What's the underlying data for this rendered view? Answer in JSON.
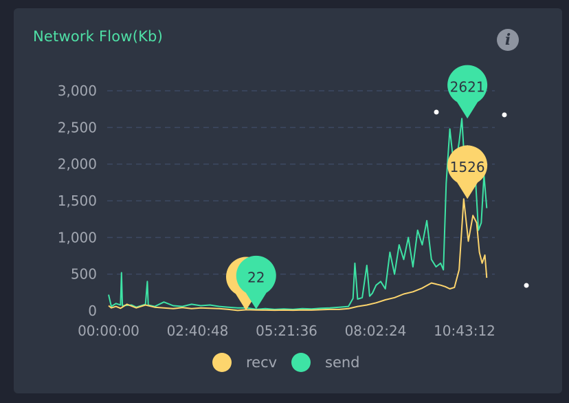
{
  "header": {
    "title": "Network Flow(Kb)",
    "info_icon": "info-icon",
    "info_glyph": "i"
  },
  "chart_data": {
    "type": "line",
    "title": "Network Flow(Kb)",
    "xlabel": "",
    "ylabel": "",
    "ylim": [
      0,
      3000
    ],
    "yticks": [
      0,
      500,
      1000,
      1500,
      2000,
      2500,
      3000
    ],
    "ytick_labels": [
      "0",
      "500",
      "1,000",
      "1,500",
      "2,000",
      "2,500",
      "3,000"
    ],
    "xtick_labels": [
      "00:00:00",
      "02:40:48",
      "05:21:36",
      "08:02:24",
      "10:43:12"
    ],
    "xtick_seconds": [
      0,
      9648,
      19296,
      28944,
      38592
    ],
    "grid": "horizontal dashed",
    "legend_position": "bottom",
    "series": [
      {
        "name": "recv",
        "color": "#fdd56d",
        "x": [
          0,
          300,
          800,
          1300,
          2000,
          3000,
          4000,
          5000,
          6000,
          7000,
          8000,
          9000,
          10000,
          11000,
          12000,
          13000,
          14000,
          15000,
          16000,
          17000,
          18000,
          19000,
          20000,
          21000,
          22000,
          23000,
          24000,
          25000,
          26000,
          27000,
          28000,
          29000,
          30000,
          31000,
          32000,
          33000,
          34000,
          35000,
          36000,
          36500,
          37000,
          37500,
          38000,
          38500,
          39000,
          39500,
          39900,
          40200,
          40500,
          40800,
          41000
        ],
        "y": [
          70,
          40,
          60,
          35,
          90,
          40,
          80,
          50,
          40,
          30,
          45,
          30,
          40,
          35,
          30,
          20,
          6,
          15,
          12,
          10,
          8,
          10,
          8,
          12,
          10,
          15,
          20,
          20,
          30,
          60,
          80,
          110,
          150,
          180,
          230,
          260,
          310,
          380,
          350,
          330,
          300,
          320,
          560,
          1526,
          950,
          1300,
          1200,
          800,
          650,
          760,
          450
        ],
        "markers": [
          {
            "x": 14900,
            "y": 6,
            "label": "6"
          },
          {
            "x": 38900,
            "y": 1526,
            "label": "1526"
          }
        ]
      },
      {
        "name": "send",
        "color": "#3ee3a5",
        "x": [
          0,
          300,
          800,
          1300,
          1400,
          1500,
          2500,
          3000,
          4000,
          4200,
          4300,
          5000,
          6000,
          7000,
          8000,
          9000,
          10000,
          11000,
          12000,
          13000,
          14000,
          15000,
          16000,
          17000,
          18000,
          19000,
          20000,
          21000,
          22000,
          23000,
          24000,
          25000,
          26000,
          26500,
          26700,
          27000,
          27500,
          28000,
          28300,
          28600,
          29000,
          29500,
          30000,
          30500,
          31000,
          31500,
          32000,
          32500,
          33000,
          33500,
          34000,
          34500,
          35000,
          35500,
          36000,
          36300,
          36600,
          37000,
          37500,
          38000,
          38300,
          38600,
          38900,
          39200,
          39500,
          39800,
          40100,
          40400,
          40700,
          41000
        ],
        "y": [
          220,
          60,
          100,
          80,
          520,
          70,
          80,
          50,
          90,
          400,
          80,
          60,
          120,
          70,
          60,
          90,
          70,
          80,
          60,
          50,
          40,
          40,
          22,
          30,
          20,
          25,
          20,
          30,
          25,
          35,
          40,
          50,
          60,
          170,
          650,
          160,
          180,
          620,
          200,
          240,
          350,
          400,
          300,
          800,
          500,
          900,
          700,
          1000,
          600,
          1100,
          900,
          1230,
          700,
          600,
          650,
          560,
          1740,
          2480,
          1900,
          2300,
          2621,
          2000,
          2250,
          1700,
          1800,
          1750,
          1100,
          1200,
          1850,
          1400
        ]
      }
    ]
  },
  "markers": {
    "recv_low": "6",
    "send_low": "22",
    "recv_high": "1526",
    "send_high": "2621"
  },
  "legend": [
    {
      "name": "recv",
      "color": "#fdd56d"
    },
    {
      "name": "send",
      "color": "#3ee3a5"
    }
  ]
}
